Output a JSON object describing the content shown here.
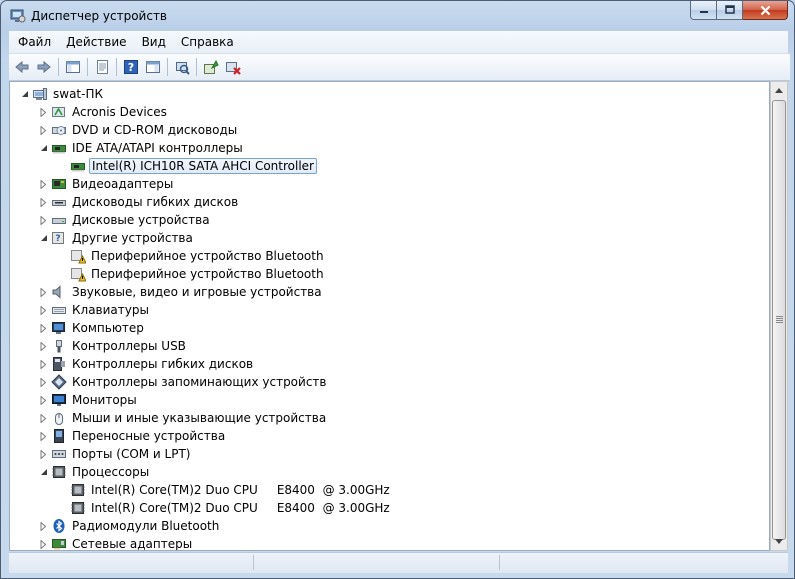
{
  "window": {
    "title": "Диспетчер устройств",
    "icon": "device-manager-icon"
  },
  "menu": [
    {
      "label": "Файл",
      "name": "menu-file"
    },
    {
      "label": "Действие",
      "name": "menu-action"
    },
    {
      "label": "Вид",
      "name": "menu-view"
    },
    {
      "label": "Справка",
      "name": "menu-help"
    }
  ],
  "toolbar": [
    {
      "name": "back-button",
      "icon": "arrow-left-icon"
    },
    {
      "name": "forward-button",
      "icon": "arrow-right-icon"
    },
    {
      "sep": true
    },
    {
      "name": "show-hide-console-tree-button",
      "icon": "console-tree-icon"
    },
    {
      "sep": true
    },
    {
      "name": "properties-button",
      "icon": "properties-icon"
    },
    {
      "sep": true
    },
    {
      "name": "help-button",
      "icon": "help-icon"
    },
    {
      "name": "show-hide-action-pane-button",
      "icon": "action-pane-icon"
    },
    {
      "sep": true
    },
    {
      "name": "scan-hardware-changes-button",
      "icon": "scan-hardware-icon"
    },
    {
      "sep": true
    },
    {
      "name": "update-driver-button",
      "icon": "update-driver-icon"
    },
    {
      "name": "uninstall-button",
      "icon": "uninstall-icon"
    }
  ],
  "tree": [
    {
      "label": "swat-ПК",
      "level": 0,
      "expander": "expanded",
      "icon": "computer-icon"
    },
    {
      "label": "Acronis Devices",
      "level": 1,
      "expander": "collapsed",
      "icon": "acronis-icon"
    },
    {
      "label": "DVD и CD-ROM дисководы",
      "level": 1,
      "expander": "collapsed",
      "icon": "dvd-drive-icon"
    },
    {
      "label": "IDE ATA/ATAPI контроллеры",
      "level": 1,
      "expander": "expanded",
      "icon": "ide-controller-icon"
    },
    {
      "label": "Intel(R) ICH10R SATA AHCI Controller",
      "level": 2,
      "expander": "none",
      "icon": "ide-controller-icon",
      "selected": true
    },
    {
      "label": "Видеоадаптеры",
      "level": 1,
      "expander": "collapsed",
      "icon": "display-adapter-icon"
    },
    {
      "label": "Дисководы гибких дисков",
      "level": 1,
      "expander": "collapsed",
      "icon": "floppy-drive-icon"
    },
    {
      "label": "Дисковые устройства",
      "level": 1,
      "expander": "collapsed",
      "icon": "disk-drive-icon"
    },
    {
      "label": "Другие устройства",
      "level": 1,
      "expander": "expanded",
      "icon": "unknown-device-icon"
    },
    {
      "label": "Периферийное устройство Bluetooth",
      "level": 2,
      "expander": "none",
      "icon": "warning-device-icon"
    },
    {
      "label": "Периферийное устройство Bluetooth",
      "level": 2,
      "expander": "none",
      "icon": "warning-device-icon"
    },
    {
      "label": "Звуковые, видео и игровые устройства",
      "level": 1,
      "expander": "collapsed",
      "icon": "speaker-icon"
    },
    {
      "label": "Клавиатуры",
      "level": 1,
      "expander": "collapsed",
      "icon": "keyboard-icon"
    },
    {
      "label": "Компьютер",
      "level": 1,
      "expander": "collapsed",
      "icon": "monitor-computer-icon"
    },
    {
      "label": "Контроллеры USB",
      "level": 1,
      "expander": "collapsed",
      "icon": "usb-icon"
    },
    {
      "label": "Контроллеры гибких дисков",
      "level": 1,
      "expander": "collapsed",
      "icon": "floppy-controller-icon"
    },
    {
      "label": "Контроллеры запоминающих устройств",
      "level": 1,
      "expander": "collapsed",
      "icon": "storage-controller-icon"
    },
    {
      "label": "Мониторы",
      "level": 1,
      "expander": "collapsed",
      "icon": "monitor-icon"
    },
    {
      "label": "Мыши и иные указывающие устройства",
      "level": 1,
      "expander": "collapsed",
      "icon": "mouse-icon"
    },
    {
      "label": "Переносные устройства",
      "level": 1,
      "expander": "collapsed",
      "icon": "portable-device-icon"
    },
    {
      "label": "Порты (COM и LPT)",
      "level": 1,
      "expander": "collapsed",
      "icon": "port-icon"
    },
    {
      "label": "Процессоры",
      "level": 1,
      "expander": "expanded",
      "icon": "processor-icon"
    },
    {
      "label": "Intel(R) Core(TM)2 Duo CPU     E8400  @ 3.00GHz",
      "level": 2,
      "expander": "none",
      "icon": "processor-icon"
    },
    {
      "label": "Intel(R) Core(TM)2 Duo CPU     E8400  @ 3.00GHz",
      "level": 2,
      "expander": "none",
      "icon": "processor-icon"
    },
    {
      "label": "Радиомодули Bluetooth",
      "level": 1,
      "expander": "collapsed",
      "icon": "bluetooth-icon"
    },
    {
      "label": "Сетевые адаптеры",
      "level": 1,
      "expander": "collapsed",
      "icon": "network-adapter-icon"
    }
  ]
}
